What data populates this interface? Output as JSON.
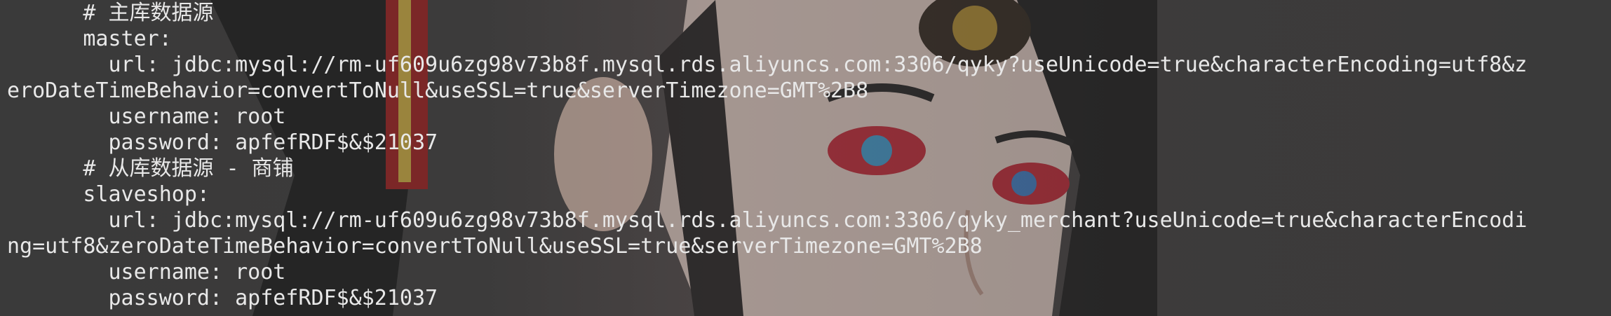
{
  "terminal": {
    "lines": [
      "      # 主库数据源",
      "      master:",
      "        url: jdbc:mysql://rm-uf609u6zg98v73b8f.mysql.rds.aliyuncs.com:3306/qyky?useUnicode=true&characterEncoding=utf8&z",
      "eroDateTimeBehavior=convertToNull&useSSL=true&serverTimezone=GMT%2B8",
      "        username: root",
      "        password: apfefRDF$&$21037",
      "      # 从库数据源 - 商铺",
      "      slaveshop:",
      "        url: jdbc:mysql://rm-uf609u6zg98v73b8f.mysql.rds.aliyuncs.com:3306/qyky_merchant?useUnicode=true&characterEncodi",
      "ng=utf8&zeroDateTimeBehavior=convertToNull&useSSL=true&serverTimezone=GMT%2B8",
      "        username: root",
      "        password: apfefRDF$&$21037"
    ]
  },
  "colors": {
    "background": "#3a3a3a",
    "text": "#e8e8e8"
  }
}
